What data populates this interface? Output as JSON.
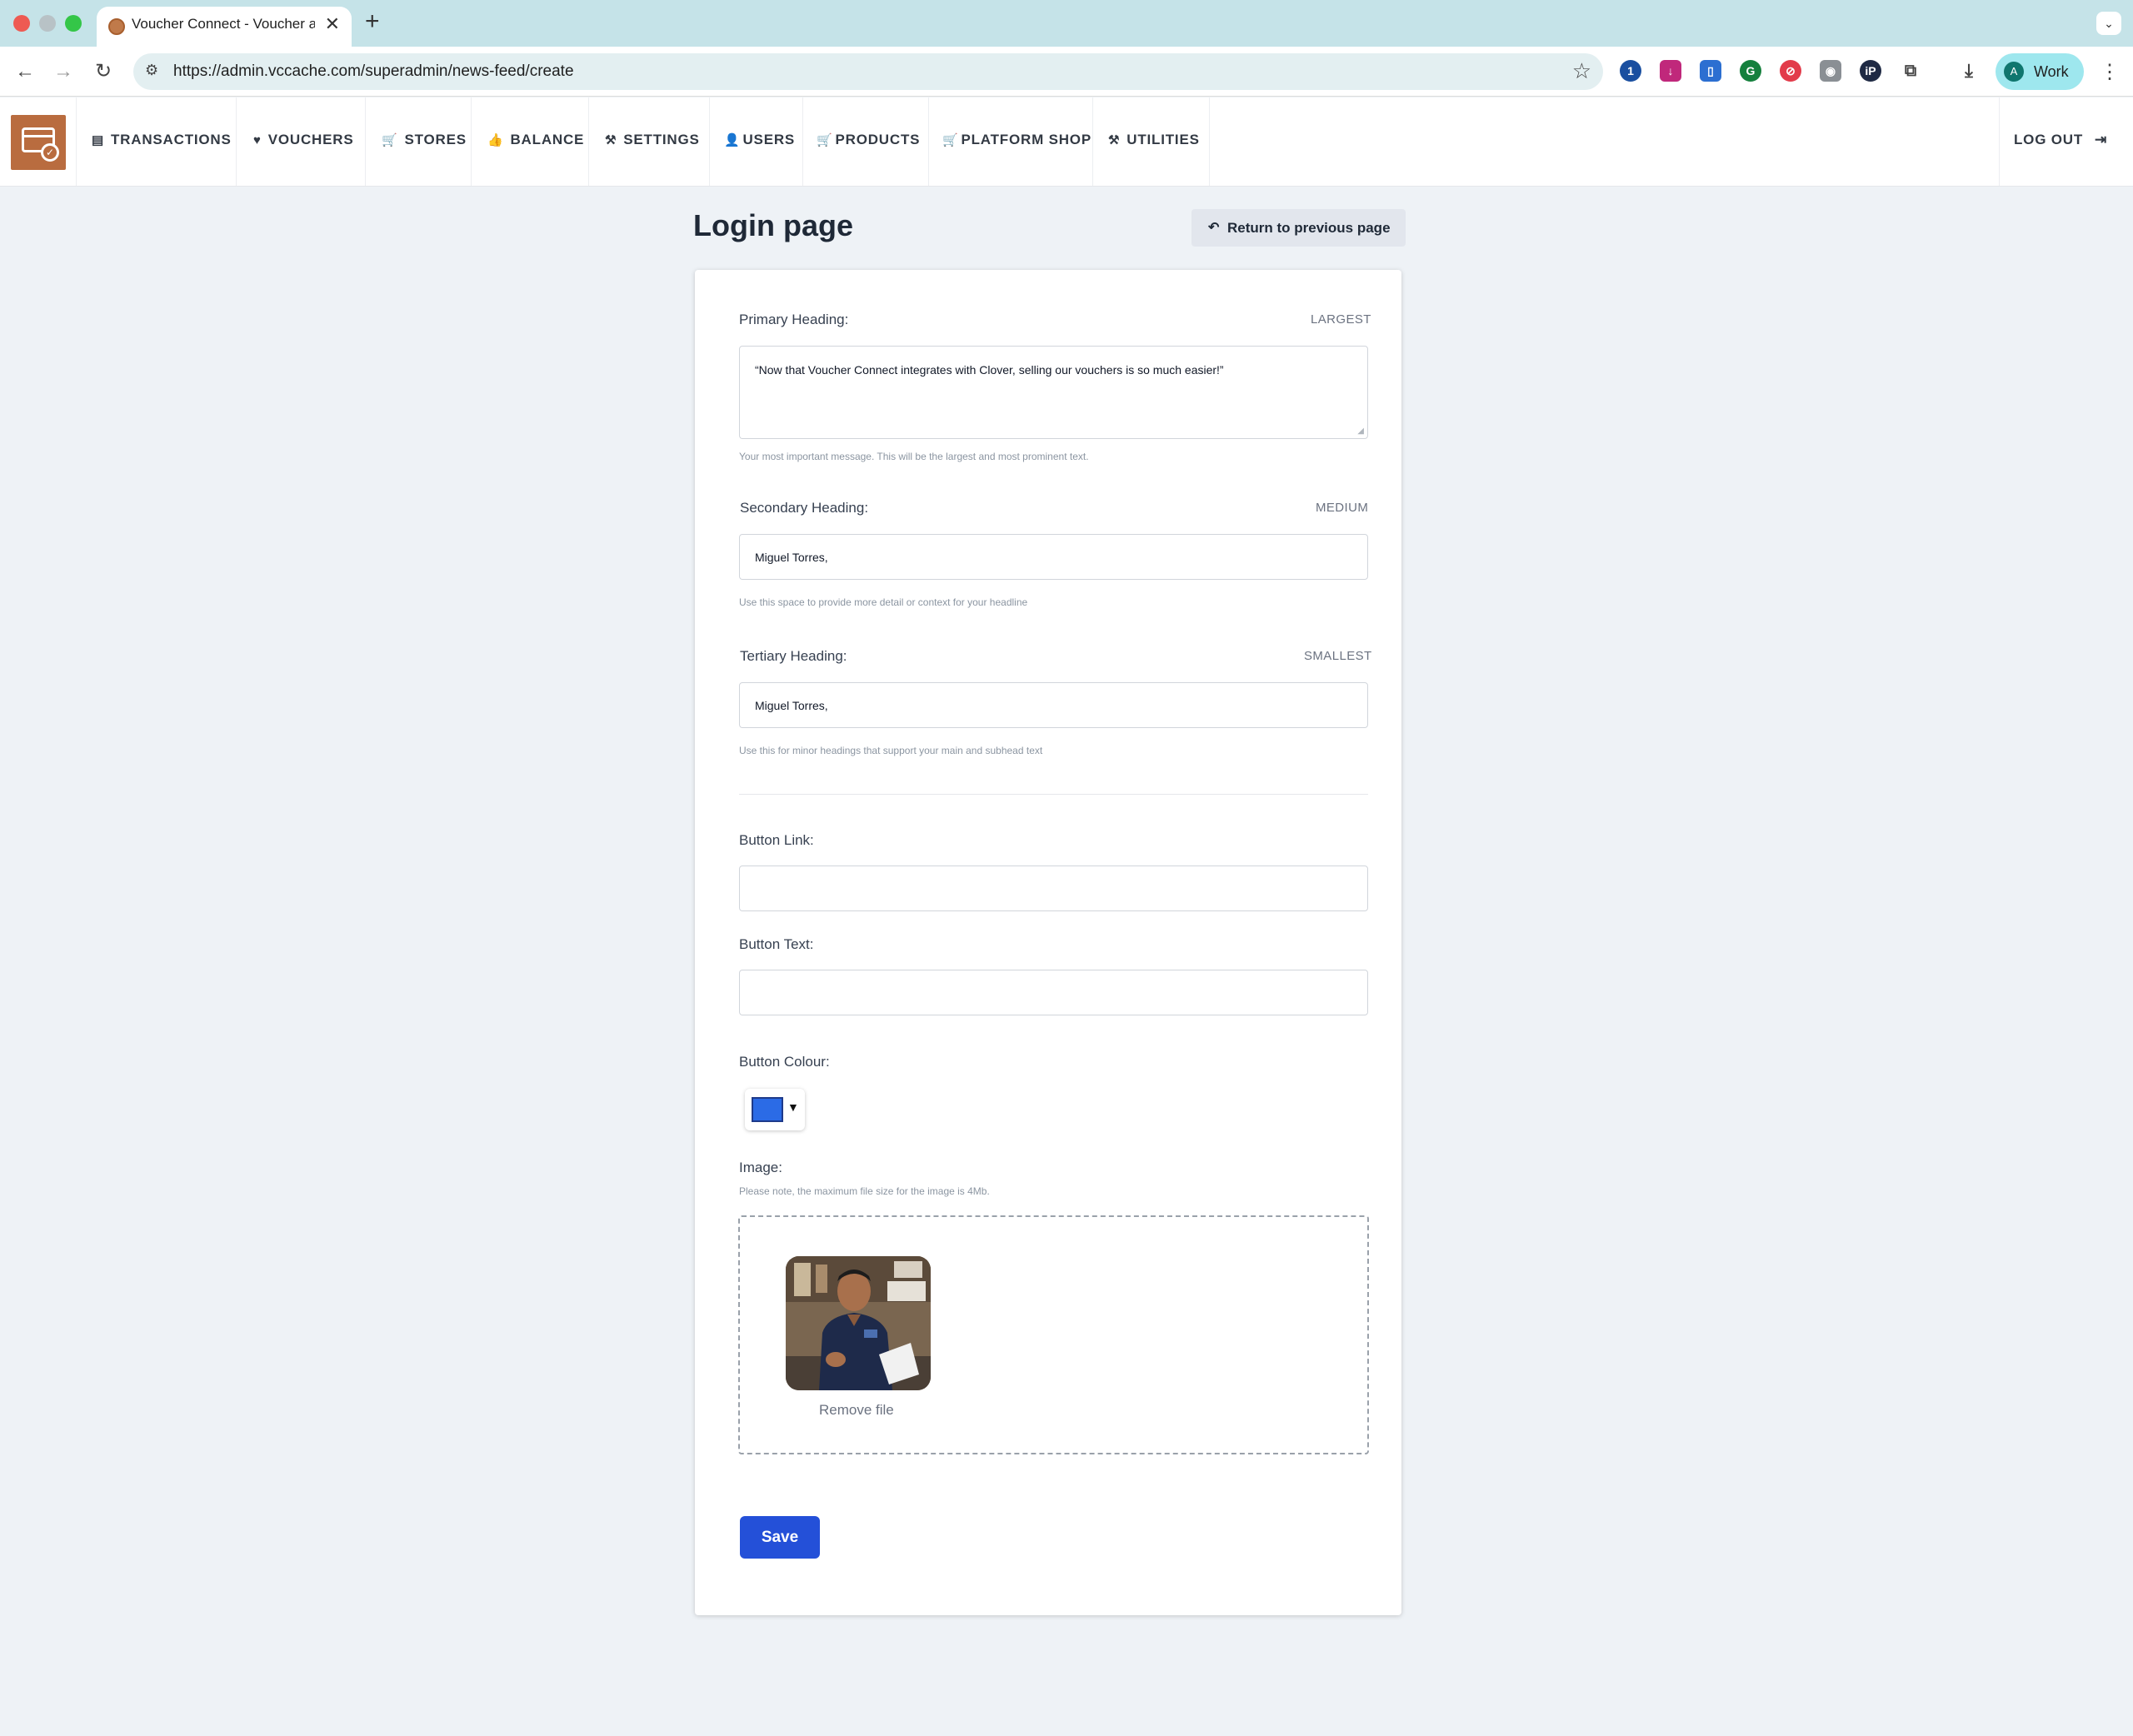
{
  "browser": {
    "tab_title": "Voucher Connect - Voucher a",
    "tab_close": "✕",
    "new_tab": "+",
    "url": "https://admin.vccache.com/superadmin/news-feed/create",
    "profile_initial": "A",
    "profile_label": "Work",
    "extensions": [
      "1password-icon",
      "download-helper-icon",
      "reader-icon",
      "grammarly-icon",
      "adblock-icon",
      "camera-icon",
      "ip-icon",
      "puzzle-icon"
    ]
  },
  "nav": {
    "items": [
      {
        "icon": "▤",
        "label": "TRANSACTIONS"
      },
      {
        "icon": "♥",
        "label": "VOUCHERS"
      },
      {
        "icon": "🛒",
        "label": "STORES"
      },
      {
        "icon": "👍",
        "label": "BALANCE"
      },
      {
        "icon": "⚒",
        "label": "SETTINGS"
      },
      {
        "icon": "👤",
        "label": "USERS"
      },
      {
        "icon": "🛒",
        "label": "PRODUCTS"
      },
      {
        "icon": "🛒",
        "label": "PLATFORM SHOP"
      },
      {
        "icon": "⚒",
        "label": "UTILITIES"
      }
    ],
    "logout_label": "LOG OUT"
  },
  "page": {
    "title": "Login page",
    "return_label": "Return to previous page"
  },
  "form": {
    "primary": {
      "label": "Primary Heading:",
      "size": "LARGEST",
      "value": "“Now that Voucher Connect integrates with Clover, selling our vouchers is so much easier!”",
      "help": "Your most important message. This will be the largest and most prominent text."
    },
    "secondary": {
      "label": "Secondary Heading:",
      "size": "MEDIUM",
      "value": "Miguel Torres,",
      "help": "Use this space to provide more detail or context for your headline"
    },
    "tertiary": {
      "label": "Tertiary Heading:",
      "size": "SMALLEST",
      "value": "Miguel Torres,",
      "help": "Use this for minor headings that support your main and subhead text"
    },
    "button_link": {
      "label": "Button Link:",
      "value": ""
    },
    "button_text": {
      "label": "Button Text:",
      "value": ""
    },
    "button_colour": {
      "label": "Button Colour:",
      "value": "#2b6be6"
    },
    "image": {
      "label": "Image:",
      "note": "Please note, the maximum file size for the image is 4Mb.",
      "remove_label": "Remove file"
    },
    "save_label": "Save"
  }
}
